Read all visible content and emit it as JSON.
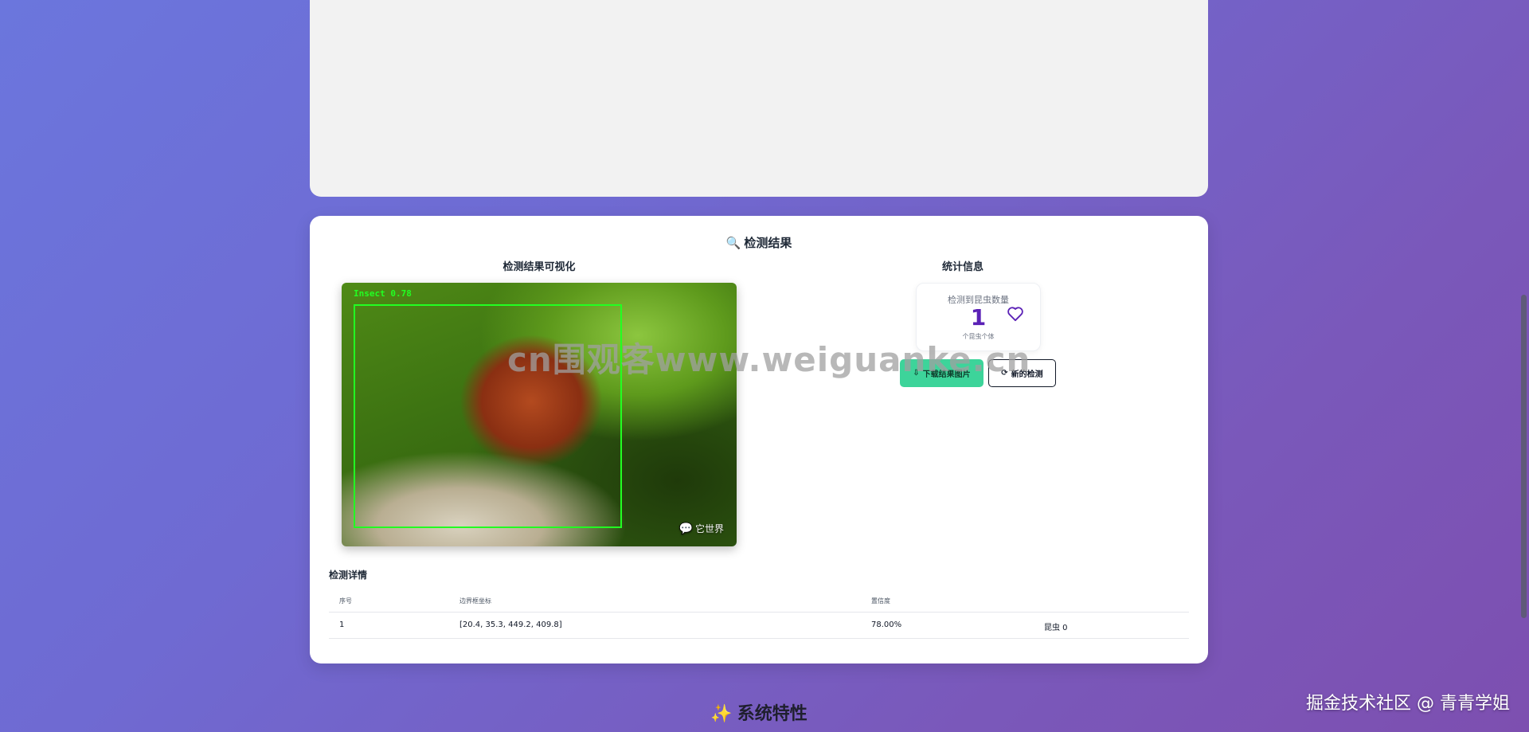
{
  "result": {
    "title_icon": "🔍",
    "title": "检测结果",
    "viz_title": "检测结果可视化",
    "stats_title": "统计信息",
    "image": {
      "box_label": "Insect 0.78",
      "corner_watermark": "它世界",
      "corner_icon": "wechat-icon"
    },
    "stats": {
      "label": "检测到昆虫数量",
      "count": "1",
      "unit": "个昆虫个体",
      "icon": "heart-icon"
    },
    "buttons": {
      "download_icon": "⇩",
      "download": "下载结果图片",
      "new_icon": "⟳",
      "new": "新的检测"
    },
    "details": {
      "title": "检测详情",
      "headers": [
        "序号",
        "边界框坐标",
        "置信度",
        ""
      ],
      "rows": [
        [
          "1",
          "[20.4, 35.3, 449.2, 409.8]",
          "78.00%",
          "昆虫 0"
        ]
      ]
    }
  },
  "overlay_watermark": "cn围观客www.weiguanke.cn",
  "features": {
    "icon": "✨",
    "title": "系统特性"
  },
  "bottom_watermark": "掘金技术社区 @ 青青学姐",
  "colors": {
    "accent_purple": "#5b21b6",
    "download_green": "#3dd49a",
    "bbox_green": "#22ff22"
  }
}
